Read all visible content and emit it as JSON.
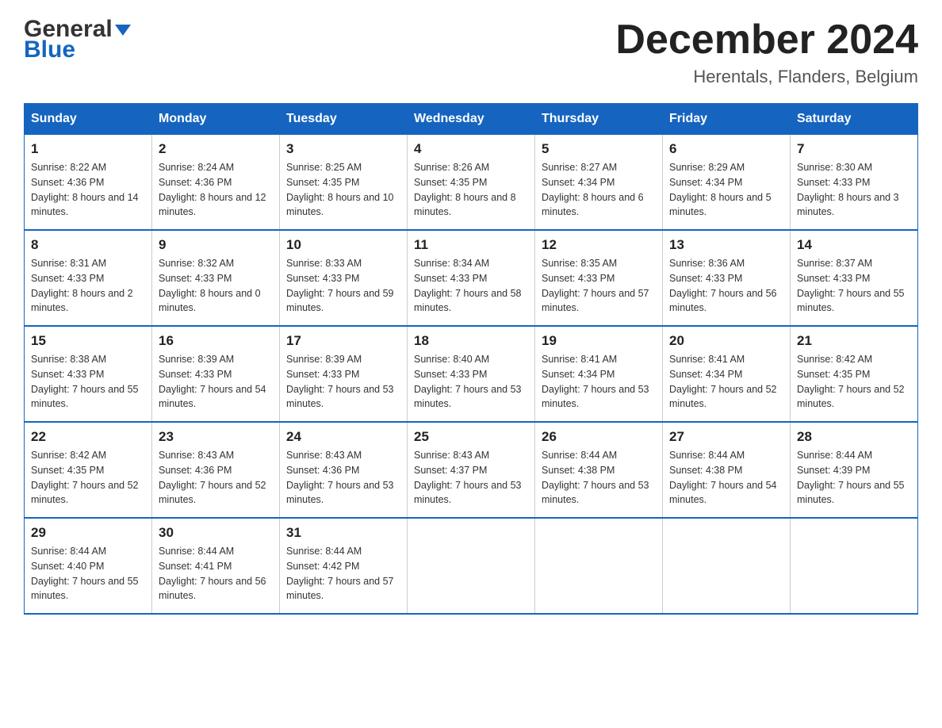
{
  "header": {
    "logo_general": "General",
    "logo_blue": "Blue",
    "month_title": "December 2024",
    "location": "Herentals, Flanders, Belgium"
  },
  "days_of_week": [
    "Sunday",
    "Monday",
    "Tuesday",
    "Wednesday",
    "Thursday",
    "Friday",
    "Saturday"
  ],
  "weeks": [
    [
      {
        "day": "1",
        "sunrise": "8:22 AM",
        "sunset": "4:36 PM",
        "daylight": "8 hours and 14 minutes."
      },
      {
        "day": "2",
        "sunrise": "8:24 AM",
        "sunset": "4:36 PM",
        "daylight": "8 hours and 12 minutes."
      },
      {
        "day": "3",
        "sunrise": "8:25 AM",
        "sunset": "4:35 PM",
        "daylight": "8 hours and 10 minutes."
      },
      {
        "day": "4",
        "sunrise": "8:26 AM",
        "sunset": "4:35 PM",
        "daylight": "8 hours and 8 minutes."
      },
      {
        "day": "5",
        "sunrise": "8:27 AM",
        "sunset": "4:34 PM",
        "daylight": "8 hours and 6 minutes."
      },
      {
        "day": "6",
        "sunrise": "8:29 AM",
        "sunset": "4:34 PM",
        "daylight": "8 hours and 5 minutes."
      },
      {
        "day": "7",
        "sunrise": "8:30 AM",
        "sunset": "4:33 PM",
        "daylight": "8 hours and 3 minutes."
      }
    ],
    [
      {
        "day": "8",
        "sunrise": "8:31 AM",
        "sunset": "4:33 PM",
        "daylight": "8 hours and 2 minutes."
      },
      {
        "day": "9",
        "sunrise": "8:32 AM",
        "sunset": "4:33 PM",
        "daylight": "8 hours and 0 minutes."
      },
      {
        "day": "10",
        "sunrise": "8:33 AM",
        "sunset": "4:33 PM",
        "daylight": "7 hours and 59 minutes."
      },
      {
        "day": "11",
        "sunrise": "8:34 AM",
        "sunset": "4:33 PM",
        "daylight": "7 hours and 58 minutes."
      },
      {
        "day": "12",
        "sunrise": "8:35 AM",
        "sunset": "4:33 PM",
        "daylight": "7 hours and 57 minutes."
      },
      {
        "day": "13",
        "sunrise": "8:36 AM",
        "sunset": "4:33 PM",
        "daylight": "7 hours and 56 minutes."
      },
      {
        "day": "14",
        "sunrise": "8:37 AM",
        "sunset": "4:33 PM",
        "daylight": "7 hours and 55 minutes."
      }
    ],
    [
      {
        "day": "15",
        "sunrise": "8:38 AM",
        "sunset": "4:33 PM",
        "daylight": "7 hours and 55 minutes."
      },
      {
        "day": "16",
        "sunrise": "8:39 AM",
        "sunset": "4:33 PM",
        "daylight": "7 hours and 54 minutes."
      },
      {
        "day": "17",
        "sunrise": "8:39 AM",
        "sunset": "4:33 PM",
        "daylight": "7 hours and 53 minutes."
      },
      {
        "day": "18",
        "sunrise": "8:40 AM",
        "sunset": "4:33 PM",
        "daylight": "7 hours and 53 minutes."
      },
      {
        "day": "19",
        "sunrise": "8:41 AM",
        "sunset": "4:34 PM",
        "daylight": "7 hours and 53 minutes."
      },
      {
        "day": "20",
        "sunrise": "8:41 AM",
        "sunset": "4:34 PM",
        "daylight": "7 hours and 52 minutes."
      },
      {
        "day": "21",
        "sunrise": "8:42 AM",
        "sunset": "4:35 PM",
        "daylight": "7 hours and 52 minutes."
      }
    ],
    [
      {
        "day": "22",
        "sunrise": "8:42 AM",
        "sunset": "4:35 PM",
        "daylight": "7 hours and 52 minutes."
      },
      {
        "day": "23",
        "sunrise": "8:43 AM",
        "sunset": "4:36 PM",
        "daylight": "7 hours and 52 minutes."
      },
      {
        "day": "24",
        "sunrise": "8:43 AM",
        "sunset": "4:36 PM",
        "daylight": "7 hours and 53 minutes."
      },
      {
        "day": "25",
        "sunrise": "8:43 AM",
        "sunset": "4:37 PM",
        "daylight": "7 hours and 53 minutes."
      },
      {
        "day": "26",
        "sunrise": "8:44 AM",
        "sunset": "4:38 PM",
        "daylight": "7 hours and 53 minutes."
      },
      {
        "day": "27",
        "sunrise": "8:44 AM",
        "sunset": "4:38 PM",
        "daylight": "7 hours and 54 minutes."
      },
      {
        "day": "28",
        "sunrise": "8:44 AM",
        "sunset": "4:39 PM",
        "daylight": "7 hours and 55 minutes."
      }
    ],
    [
      {
        "day": "29",
        "sunrise": "8:44 AM",
        "sunset": "4:40 PM",
        "daylight": "7 hours and 55 minutes."
      },
      {
        "day": "30",
        "sunrise": "8:44 AM",
        "sunset": "4:41 PM",
        "daylight": "7 hours and 56 minutes."
      },
      {
        "day": "31",
        "sunrise": "8:44 AM",
        "sunset": "4:42 PM",
        "daylight": "7 hours and 57 minutes."
      },
      null,
      null,
      null,
      null
    ]
  ]
}
